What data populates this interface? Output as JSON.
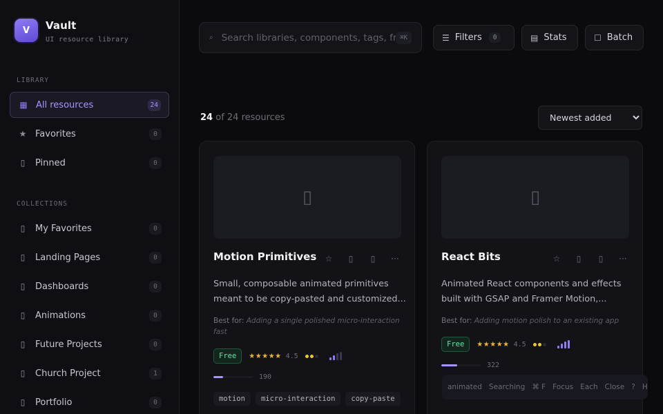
{
  "brand": {
    "logo_letter": "V",
    "name": "Vault",
    "subtitle": "UI resource library"
  },
  "library": {
    "title": "LIBRARY",
    "items": [
      {
        "label": "All resources",
        "count": "24",
        "icon": "grid-icon",
        "glyph": "▦",
        "active": true
      },
      {
        "label": "Favorites",
        "count": "0",
        "icon": "star-icon",
        "glyph": "★"
      },
      {
        "label": "Pinned",
        "count": "0",
        "icon": "pin-icon",
        "glyph": "▯"
      }
    ]
  },
  "collections": {
    "title": "COLLECTIONS",
    "items": [
      {
        "label": "My Favorites",
        "count": "0"
      },
      {
        "label": "Landing Pages",
        "count": "0"
      },
      {
        "label": "Dashboards",
        "count": "0"
      },
      {
        "label": "Animations",
        "count": "0"
      },
      {
        "label": "Future Projects",
        "count": "0"
      },
      {
        "label": "Church Project",
        "count": "1"
      },
      {
        "label": "Portfolio",
        "count": "0"
      }
    ]
  },
  "search": {
    "placeholder": "Search libraries, components, tags, fr",
    "shortcut": "⌘K"
  },
  "toolbar": {
    "filters_label": "Filters",
    "filters_count": "0",
    "stats_label": "Stats",
    "batch_label": "Batch"
  },
  "results": {
    "shown": "24",
    "of_text": "of 24 resources"
  },
  "sort": {
    "selected": "Newest added",
    "options": [
      "Newest added"
    ]
  },
  "cards": [
    {
      "title": "Motion Primitives",
      "description": "Small, composable animated primitives meant to be copy-pasted and customized...",
      "best_for_label": "Best for:",
      "best_for": "Adding a single polished micro-interaction fast",
      "price": "Free",
      "stars": "★★★★★",
      "rating": "4.5",
      "progress": 0.25,
      "count": "190",
      "tags": [
        "motion",
        "micro-interaction",
        "copy-paste"
      ]
    },
    {
      "title": "React Bits",
      "description": "Animated React components and effects built with GSAP and Framer Motion,...",
      "best_for_label": "Best for:",
      "best_for": "Adding motion polish to an existing app",
      "price": "Free",
      "stars": "★★★★★",
      "rating": "4.5",
      "progress": 0.4,
      "count": "322",
      "tags": []
    }
  ],
  "hint_bar": {
    "items": [
      "animated",
      "Searching",
      "⌘ F",
      "Focus",
      "Each",
      "Close",
      "?",
      "Help"
    ]
  },
  "colors": {
    "accent": "#8f7cf5",
    "accent_text": "#a597ff",
    "free_green": "#6fe0a6",
    "star": "#e9b634"
  }
}
